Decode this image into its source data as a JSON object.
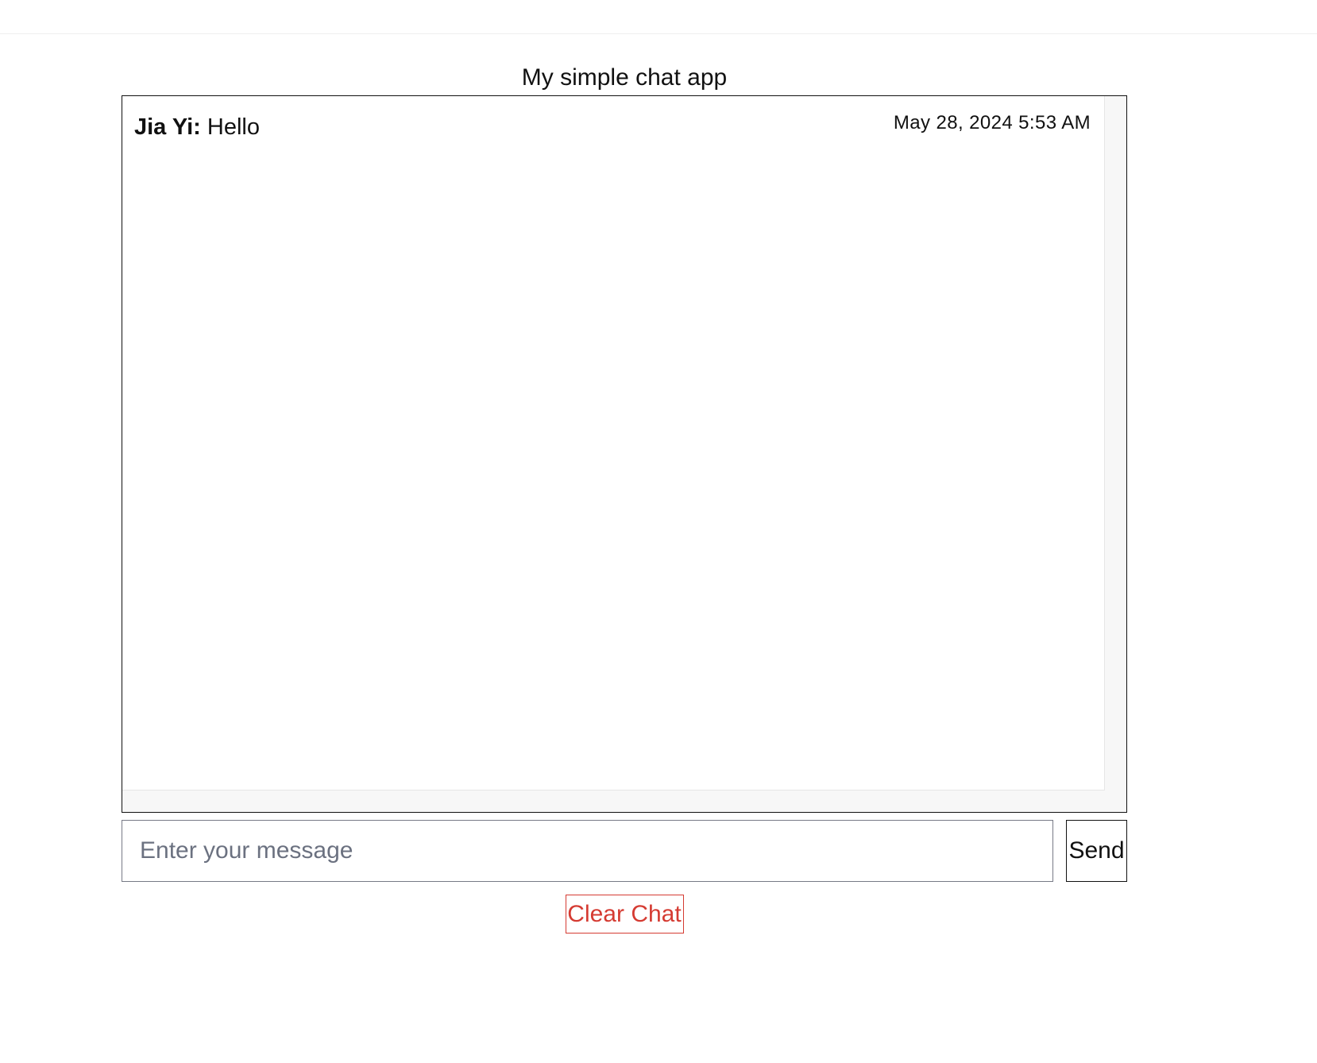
{
  "app": {
    "title": "My simple chat app"
  },
  "messages": [
    {
      "sender": "Jia Yi:",
      "text": "Hello",
      "timestamp": "May 28, 2024 5:53 AM"
    }
  ],
  "composer": {
    "placeholder": "Enter your message",
    "value": "",
    "send_label": "Send"
  },
  "actions": {
    "clear_label": "Clear Chat"
  },
  "colors": {
    "border": "#111111",
    "clear_button": "#d53b32",
    "placeholder": "#6b7180",
    "scrollbar_track": "#f7f7f7"
  }
}
